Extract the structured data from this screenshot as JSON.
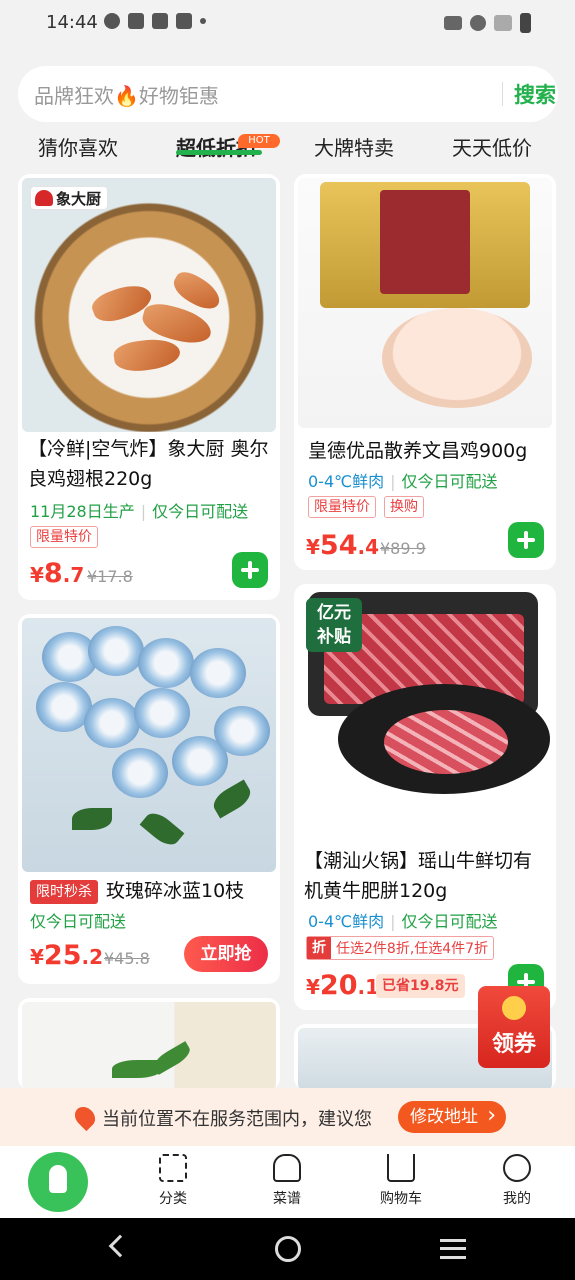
{
  "status_bar": {
    "time": "14:44",
    "icons_left": [
      "settings-status-icon",
      "mail-icon",
      "mail-icon",
      "mail-icon",
      "dot-icon"
    ],
    "icons_right": [
      "vibrate-icon",
      "wifi-icon",
      "signal-icon",
      "battery-icon"
    ]
  },
  "search": {
    "placeholder": "品牌狂欢🔥好物钜惠",
    "button_label": "搜索"
  },
  "tabs": [
    {
      "label": "猜你喜欢",
      "active": false
    },
    {
      "label": "超低折扣",
      "active": true,
      "badge": "HOT"
    },
    {
      "label": "大牌特卖",
      "active": false
    },
    {
      "label": "天天低价",
      "active": false
    }
  ],
  "products": [
    {
      "brand_badge": "象大厨",
      "title_line1": "【冷鲜|空气炸】象大厨 奥尔",
      "title_line2": "良鸡翅根220g",
      "info_a": "11月28日生产",
      "info_b": "仅今日可配送",
      "tags": [
        "限量特价"
      ],
      "price_symbol": "¥",
      "price_int": "8",
      "price_dec": ".7",
      "original_price": "¥17.8"
    },
    {
      "title_line1": "皇德优品散养文昌鸡900g",
      "info_a": "0-4℃鲜肉",
      "info_b": "仅今日可配送",
      "tags": [
        "限量特价",
        "换购"
      ],
      "price_symbol": "¥",
      "price_int": "54",
      "price_dec": ".4",
      "original_price": "¥89.9"
    },
    {
      "flash_badge": "限时秒杀",
      "title_line1": "玫瑰碎冰蓝10枝",
      "info_a": "仅今日可配送",
      "price_symbol": "¥",
      "price_int": "25",
      "price_dec": ".2",
      "original_price": "¥45.8",
      "action_label": "立即抢"
    },
    {
      "subsidy_badge_line1": "亿元",
      "subsidy_badge_line2": "补贴",
      "title_line1": "【潮汕火锅】瑶山牛鲜切有",
      "title_line2": "机黄牛肥胼120g",
      "info_a": "0-4℃鲜肉",
      "info_b": "仅今日可配送",
      "discount_label": "折",
      "discount_text": "任选2件8折,任选4件7折",
      "price_symbol": "¥",
      "price_int": "20",
      "price_dec": ".1",
      "saved_label": "已省19.8元"
    }
  ],
  "floating_coupon": {
    "label": "领券"
  },
  "notice": {
    "text": "当前位置不在服务范围内，建议您",
    "button_label": "修改地址"
  },
  "bottom_nav": [
    {
      "label": "",
      "icon": "rocket-icon"
    },
    {
      "label": "分类",
      "icon": "category-icon"
    },
    {
      "label": "菜谱",
      "icon": "chef-hat-icon"
    },
    {
      "label": "购物车",
      "icon": "cart-icon"
    },
    {
      "label": "我的",
      "icon": "profile-icon"
    }
  ],
  "colors": {
    "accent_green": "#22b14c",
    "price_red": "#f23a2f",
    "blue_info": "#1a8fd0",
    "notice_orange": "#f3581e"
  }
}
